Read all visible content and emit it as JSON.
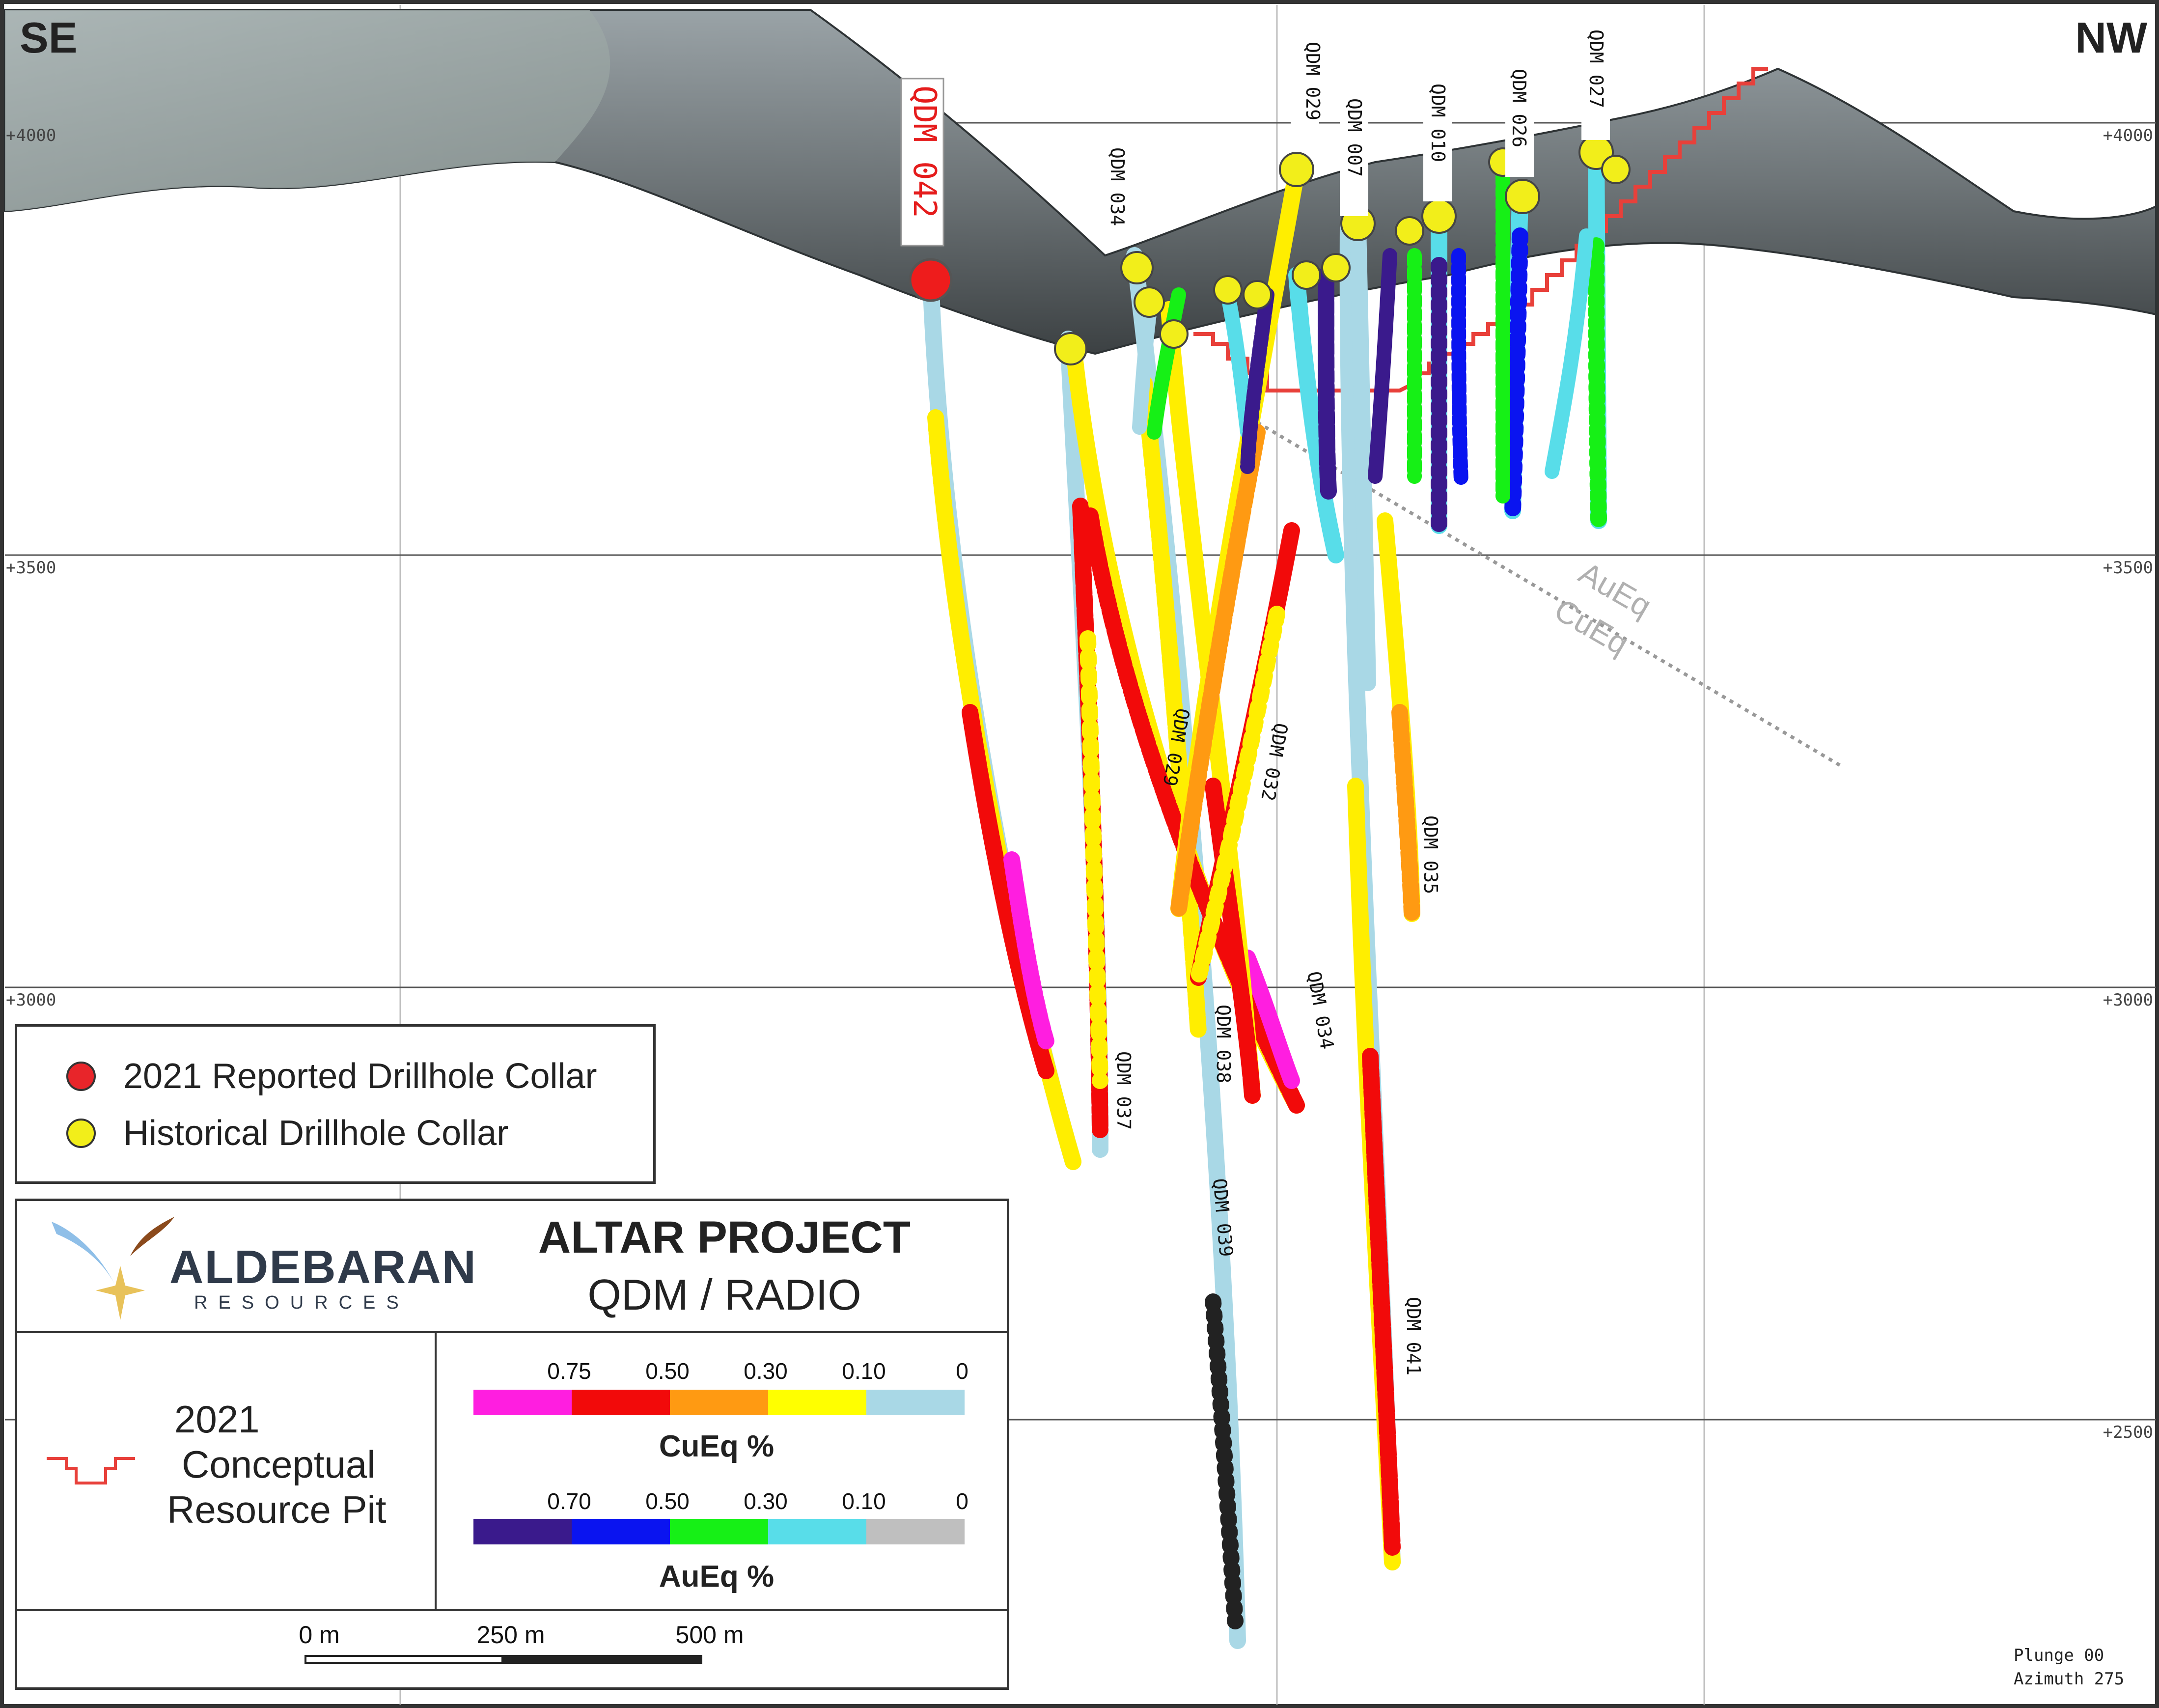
{
  "directions": {
    "left": "SE",
    "right": "NW"
  },
  "elevations": [
    "+4000",
    "+3500",
    "+3000",
    "+2500"
  ],
  "highlight_hole": {
    "label": "QDM 042",
    "color": "#ee1c1c"
  },
  "drillholes": [
    {
      "id": "QDM 037",
      "label": "QDM 037"
    },
    {
      "id": "QDM 029-lower",
      "label": "QDM 029"
    },
    {
      "id": "QDM 032",
      "label": "QDM 032"
    },
    {
      "id": "QDM 038",
      "label": "QDM 038"
    },
    {
      "id": "QDM 034-lower",
      "label": "QDM 034"
    },
    {
      "id": "QDM 039",
      "label": "QDM 039"
    },
    {
      "id": "QDM 035",
      "label": "QDM 035"
    },
    {
      "id": "QDM 041",
      "label": "QDM 041"
    },
    {
      "id": "QDM 034-upper",
      "label": "QDM 034"
    },
    {
      "id": "QDM 029-upper",
      "label": "QDM 029"
    },
    {
      "id": "QDM 007",
      "label": "QDM 007"
    },
    {
      "id": "QDM 010",
      "label": "QDM 010"
    },
    {
      "id": "QDM 026",
      "label": "QDM 026"
    },
    {
      "id": "QDM 027",
      "label": "QDM 027"
    }
  ],
  "section_line_labels": [
    "AuEq",
    "CuEq"
  ],
  "legend": {
    "items": [
      {
        "label": "2021 Reported Drillhole Collar",
        "color": "#e8252a"
      },
      {
        "label": "Historical Drillhole Collar",
        "color": "#f2ee1a"
      }
    ]
  },
  "logo": {
    "name": "ALDEBARAN",
    "subtitle": "RESOURCES"
  },
  "project": {
    "title": "ALTAR PROJECT",
    "subtitle": "QDM / RADIO"
  },
  "pit_legend": {
    "label_line1": "2021",
    "label_line2": "Conceptual",
    "label_line3": "Resource Pit",
    "color": "#e8403a"
  },
  "cueq_scale": {
    "title": "CuEq %",
    "ticks": [
      "0.75",
      "0.50",
      "0.30",
      "0.10",
      "0"
    ],
    "colors": [
      "#ff1ee0",
      "#f20a0a",
      "#ff9a12",
      "#ffff00",
      "#a9d8e6"
    ]
  },
  "aueq_scale": {
    "title": "AuEq %",
    "ticks": [
      "0.70",
      "0.50",
      "0.30",
      "0.10",
      "0"
    ],
    "colors": [
      "#3a1a8c",
      "#0a14f0",
      "#16f016",
      "#58dde9",
      "#bfbfbf"
    ]
  },
  "scale_bar": {
    "labels": [
      "0 m",
      "250 m",
      "500 m"
    ]
  },
  "footer": {
    "plunge": "Plunge 00",
    "azimuth": "Azimuth 275"
  }
}
